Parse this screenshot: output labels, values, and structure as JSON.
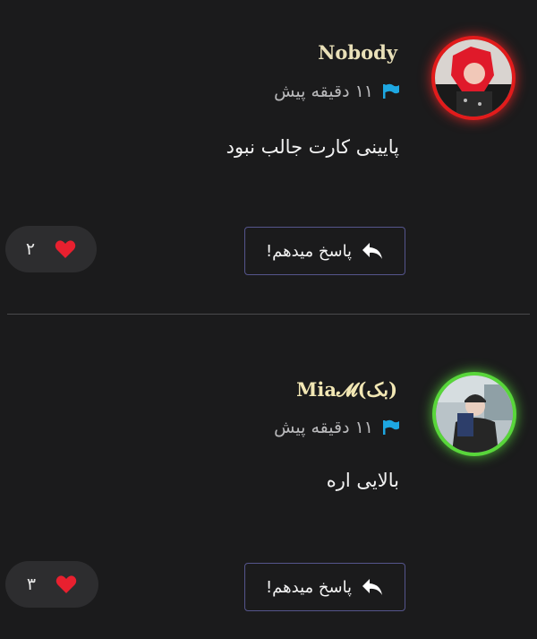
{
  "comments": [
    {
      "username": "Nobody",
      "time": "۱۱ دقیقه پیش",
      "text": "پایینی کارت جالب نبود",
      "reply_label": "پاسخ میدهم!",
      "likes": "۲",
      "ring_color": "#e21b1b"
    },
    {
      "username": "Mia𝓜(بک)",
      "time": "۱۱ دقیقه پیش",
      "text": "بالایی اره",
      "reply_label": "پاسخ میدهم!",
      "likes": "۳",
      "ring_color": "#58d63a"
    }
  ],
  "colors": {
    "background": "#1b1b1c",
    "flag": "#1ea7e1",
    "heart": "#e8202f",
    "button_border": "#55558c"
  }
}
